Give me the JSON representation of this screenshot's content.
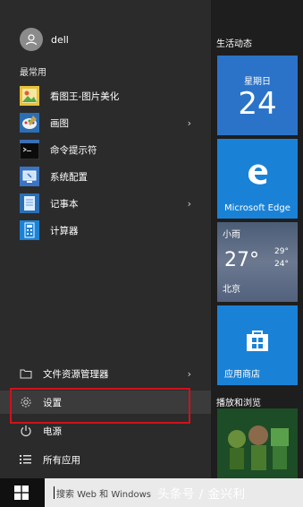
{
  "user": {
    "name": "dell"
  },
  "most_used": {
    "label": "最常用",
    "items": [
      {
        "label": "看图王-图片美化",
        "has_arrow": false,
        "icon": "photo-viewer-icon"
      },
      {
        "label": "画图",
        "has_arrow": true,
        "icon": "paint-icon"
      },
      {
        "label": "命令提示符",
        "has_arrow": false,
        "icon": "command-prompt-icon"
      },
      {
        "label": "系统配置",
        "has_arrow": false,
        "icon": "system-config-icon"
      },
      {
        "label": "记事本",
        "has_arrow": true,
        "icon": "notepad-icon"
      },
      {
        "label": "计算器",
        "has_arrow": false,
        "icon": "calculator-icon"
      }
    ]
  },
  "bottom": {
    "file_explorer": "文件资源管理器",
    "settings": "设置",
    "power": "电源",
    "all_apps": "所有应用"
  },
  "tiles": {
    "group1": "生活动态",
    "calendar": {
      "day": "星期日",
      "date": "24"
    },
    "edge": "Microsoft Edge",
    "weather": {
      "condition": "小雨",
      "temp": "27°",
      "high": "29°",
      "low": "24°",
      "location": "北京"
    },
    "store": "应用商店",
    "group2": "播放和浏览"
  },
  "taskbar": {
    "search_text": "搜索 Web 和 Windows"
  },
  "watermark": "头条号 / 金兴利",
  "colors": {
    "accent": "#1a82d6",
    "highlight": "#d0111b"
  }
}
